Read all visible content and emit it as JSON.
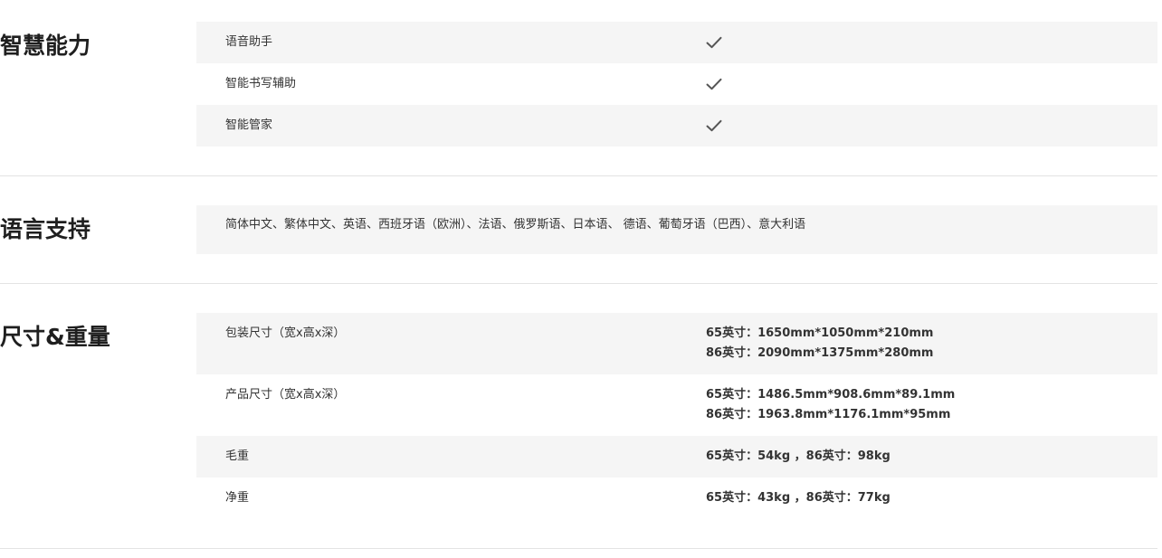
{
  "smart": {
    "title": "智慧能力",
    "rows": [
      {
        "label": "语音助手",
        "value_icon": "check-icon"
      },
      {
        "label": "智能书写辅助",
        "value_icon": "check-icon"
      },
      {
        "label": "智能管家",
        "value_icon": "check-icon"
      }
    ]
  },
  "language": {
    "title": "语言支持",
    "text": "简体中文、繁体中文、英语、西班牙语（欧洲）、法语、俄罗斯语、日本语、 德语、葡萄牙语（巴西）、意大利语"
  },
  "size": {
    "title": "尺寸&重量",
    "rows": [
      {
        "label": "包装尺寸（宽x高x深）",
        "lines": [
          "65英寸：1650mm*1050mm*210mm",
          "86英寸：2090mm*1375mm*280mm"
        ]
      },
      {
        "label": "产品尺寸（宽x高x深）",
        "lines": [
          "65英寸：1486.5mm*908.6mm*89.1mm",
          "86英寸：1963.8mm*1176.1mm*95mm"
        ]
      },
      {
        "label": "毛重",
        "lines": [
          "65英寸：54kg ，86英寸：98kg"
        ]
      },
      {
        "label": "净重",
        "lines": [
          "65英寸：43kg ，86英寸：77kg"
        ]
      }
    ]
  },
  "colors": {
    "row_shade": "#f5f5f5",
    "divider": "#e3e3e3",
    "title": "#1f1f1f",
    "text": "#333333",
    "check": "#555555"
  }
}
